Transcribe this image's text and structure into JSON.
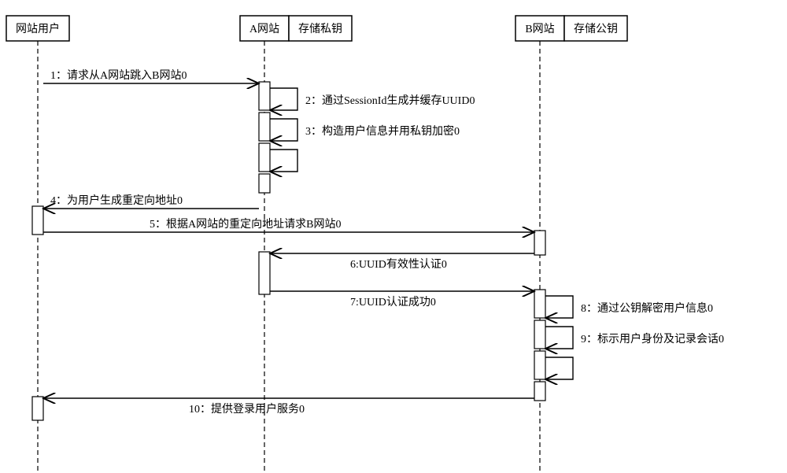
{
  "participants": {
    "user": {
      "label": "网站用户"
    },
    "siteA": {
      "label": "A网站"
    },
    "keyA": {
      "label": "存储私钥"
    },
    "siteB": {
      "label": "B网站"
    },
    "keyB": {
      "label": "存储公钥"
    }
  },
  "messages": {
    "m1": "1：请求从A网站跳入B网站0",
    "m2": "2：通过SessionId生成并缓存UUID0",
    "m3": "3：构造用户信息并用私钥加密0",
    "m4": "4：为用户生成重定向地址0",
    "m5": "5：根据A网站的重定向地址请求B网站0",
    "m6": "6:UUID有效性认证0",
    "m7": "7:UUID认证成功0",
    "m8": "8：通过公钥解密用户信息0",
    "m9": "9：标示用户身份及记录会话0",
    "m10": "10：提供登录用户服务0"
  }
}
